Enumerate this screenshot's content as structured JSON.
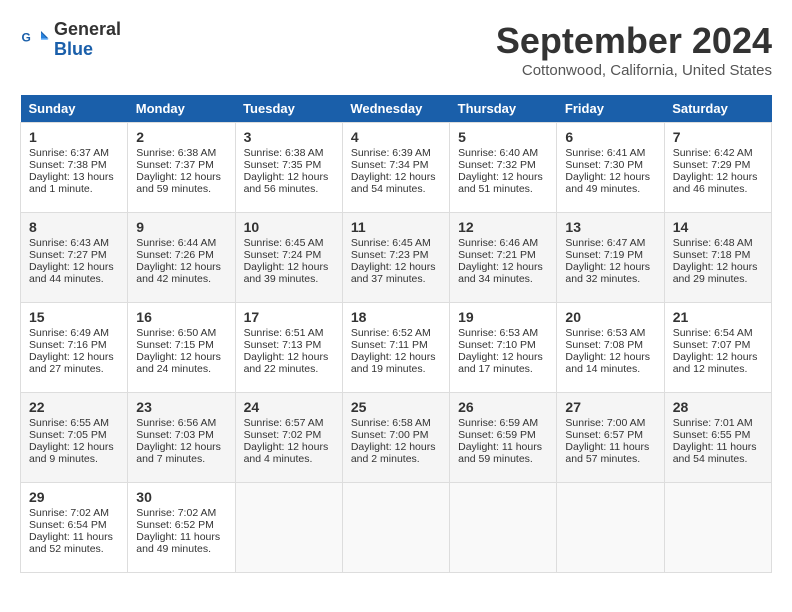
{
  "header": {
    "logo_line1": "General",
    "logo_line2": "Blue",
    "month": "September 2024",
    "location": "Cottonwood, California, United States"
  },
  "days_of_week": [
    "Sunday",
    "Monday",
    "Tuesday",
    "Wednesday",
    "Thursday",
    "Friday",
    "Saturday"
  ],
  "weeks": [
    [
      {
        "day": "1",
        "sunrise": "6:37 AM",
        "sunset": "7:38 PM",
        "daylight": "13 hours and 1 minute."
      },
      {
        "day": "2",
        "sunrise": "6:38 AM",
        "sunset": "7:37 PM",
        "daylight": "12 hours and 59 minutes."
      },
      {
        "day": "3",
        "sunrise": "6:38 AM",
        "sunset": "7:35 PM",
        "daylight": "12 hours and 56 minutes."
      },
      {
        "day": "4",
        "sunrise": "6:39 AM",
        "sunset": "7:34 PM",
        "daylight": "12 hours and 54 minutes."
      },
      {
        "day": "5",
        "sunrise": "6:40 AM",
        "sunset": "7:32 PM",
        "daylight": "12 hours and 51 minutes."
      },
      {
        "day": "6",
        "sunrise": "6:41 AM",
        "sunset": "7:30 PM",
        "daylight": "12 hours and 49 minutes."
      },
      {
        "day": "7",
        "sunrise": "6:42 AM",
        "sunset": "7:29 PM",
        "daylight": "12 hours and 46 minutes."
      }
    ],
    [
      {
        "day": "8",
        "sunrise": "6:43 AM",
        "sunset": "7:27 PM",
        "daylight": "12 hours and 44 minutes."
      },
      {
        "day": "9",
        "sunrise": "6:44 AM",
        "sunset": "7:26 PM",
        "daylight": "12 hours and 42 minutes."
      },
      {
        "day": "10",
        "sunrise": "6:45 AM",
        "sunset": "7:24 PM",
        "daylight": "12 hours and 39 minutes."
      },
      {
        "day": "11",
        "sunrise": "6:45 AM",
        "sunset": "7:23 PM",
        "daylight": "12 hours and 37 minutes."
      },
      {
        "day": "12",
        "sunrise": "6:46 AM",
        "sunset": "7:21 PM",
        "daylight": "12 hours and 34 minutes."
      },
      {
        "day": "13",
        "sunrise": "6:47 AM",
        "sunset": "7:19 PM",
        "daylight": "12 hours and 32 minutes."
      },
      {
        "day": "14",
        "sunrise": "6:48 AM",
        "sunset": "7:18 PM",
        "daylight": "12 hours and 29 minutes."
      }
    ],
    [
      {
        "day": "15",
        "sunrise": "6:49 AM",
        "sunset": "7:16 PM",
        "daylight": "12 hours and 27 minutes."
      },
      {
        "day": "16",
        "sunrise": "6:50 AM",
        "sunset": "7:15 PM",
        "daylight": "12 hours and 24 minutes."
      },
      {
        "day": "17",
        "sunrise": "6:51 AM",
        "sunset": "7:13 PM",
        "daylight": "12 hours and 22 minutes."
      },
      {
        "day": "18",
        "sunrise": "6:52 AM",
        "sunset": "7:11 PM",
        "daylight": "12 hours and 19 minutes."
      },
      {
        "day": "19",
        "sunrise": "6:53 AM",
        "sunset": "7:10 PM",
        "daylight": "12 hours and 17 minutes."
      },
      {
        "day": "20",
        "sunrise": "6:53 AM",
        "sunset": "7:08 PM",
        "daylight": "12 hours and 14 minutes."
      },
      {
        "day": "21",
        "sunrise": "6:54 AM",
        "sunset": "7:07 PM",
        "daylight": "12 hours and 12 minutes."
      }
    ],
    [
      {
        "day": "22",
        "sunrise": "6:55 AM",
        "sunset": "7:05 PM",
        "daylight": "12 hours and 9 minutes."
      },
      {
        "day": "23",
        "sunrise": "6:56 AM",
        "sunset": "7:03 PM",
        "daylight": "12 hours and 7 minutes."
      },
      {
        "day": "24",
        "sunrise": "6:57 AM",
        "sunset": "7:02 PM",
        "daylight": "12 hours and 4 minutes."
      },
      {
        "day": "25",
        "sunrise": "6:58 AM",
        "sunset": "7:00 PM",
        "daylight": "12 hours and 2 minutes."
      },
      {
        "day": "26",
        "sunrise": "6:59 AM",
        "sunset": "6:59 PM",
        "daylight": "11 hours and 59 minutes."
      },
      {
        "day": "27",
        "sunrise": "7:00 AM",
        "sunset": "6:57 PM",
        "daylight": "11 hours and 57 minutes."
      },
      {
        "day": "28",
        "sunrise": "7:01 AM",
        "sunset": "6:55 PM",
        "daylight": "11 hours and 54 minutes."
      }
    ],
    [
      {
        "day": "29",
        "sunrise": "7:02 AM",
        "sunset": "6:54 PM",
        "daylight": "11 hours and 52 minutes."
      },
      {
        "day": "30",
        "sunrise": "7:02 AM",
        "sunset": "6:52 PM",
        "daylight": "11 hours and 49 minutes."
      },
      null,
      null,
      null,
      null,
      null
    ]
  ]
}
